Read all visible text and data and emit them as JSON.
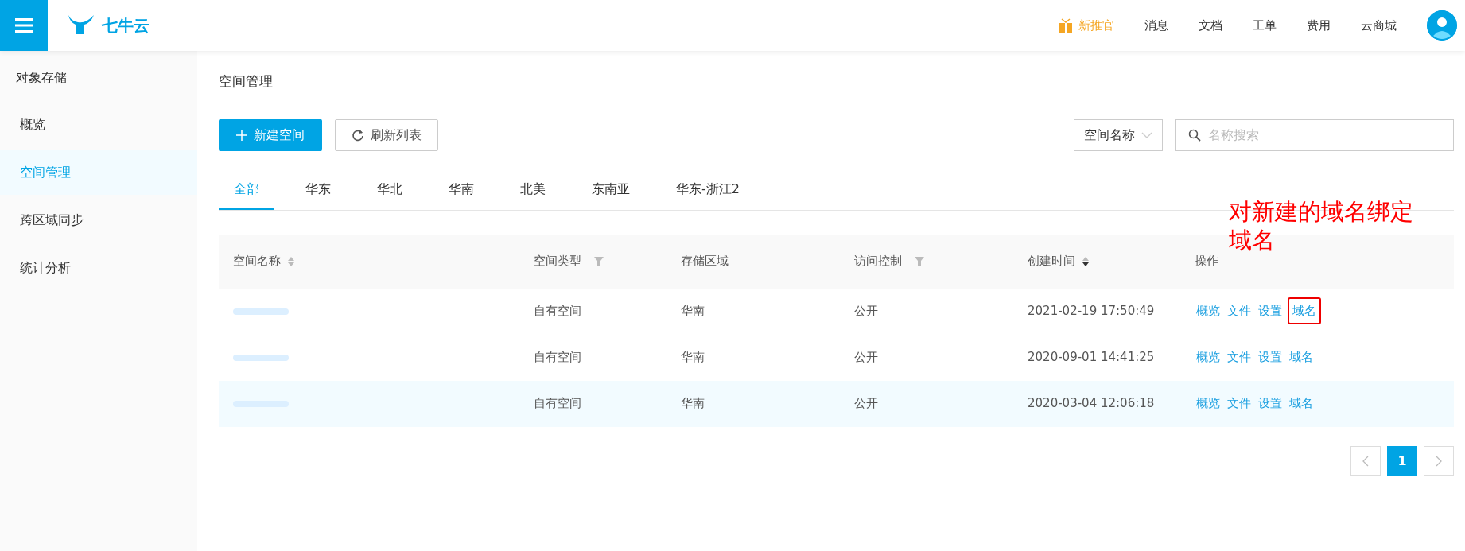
{
  "header": {
    "logo_text": "七牛云",
    "links": [
      {
        "label": "新推官",
        "kind": "promo"
      },
      {
        "label": "消息",
        "kind": "plain"
      },
      {
        "label": "文档",
        "kind": "plain"
      },
      {
        "label": "工单",
        "kind": "plain"
      },
      {
        "label": "费用",
        "kind": "plain"
      },
      {
        "label": "云商城",
        "kind": "plain"
      }
    ]
  },
  "sidebar": {
    "title": "对象存储",
    "items": [
      {
        "label": "概览",
        "selected": false
      },
      {
        "label": "空间管理",
        "selected": true
      },
      {
        "label": "跨区域同步",
        "selected": false
      },
      {
        "label": "统计分析",
        "selected": false
      }
    ]
  },
  "page_title": "空间管理",
  "toolbar": {
    "create_button": "新建空间",
    "refresh_button": "刷新列表",
    "search_by": "空间名称",
    "search": {
      "placeholder": "名称搜索"
    }
  },
  "tabs": [
    {
      "label": "全部",
      "selected": true
    },
    {
      "label": "华东",
      "selected": false
    },
    {
      "label": "华北",
      "selected": false
    },
    {
      "label": "华南",
      "selected": false
    },
    {
      "label": "北美",
      "selected": false
    },
    {
      "label": "东南亚",
      "selected": false
    },
    {
      "label": "华东-浙江2",
      "selected": false
    }
  ],
  "table": {
    "columns": [
      {
        "label": "空间名称",
        "kind": "sortable",
        "sorted_desc": false
      },
      {
        "label": "空间类型",
        "kind": "filterable"
      },
      {
        "label": "存储区域",
        "kind": "plain"
      },
      {
        "label": "访问控制",
        "kind": "filterable"
      },
      {
        "label": "创建时间",
        "kind": "sortable",
        "sorted_desc": true
      },
      {
        "label": "操作",
        "kind": "plain"
      }
    ],
    "rows": [
      {
        "highlighted": false,
        "type": "自有空间",
        "region": "华南",
        "access": "公开",
        "created": "2021-02-19 17:50:49",
        "actions": [
          {
            "label": "概览",
            "boxed": false
          },
          {
            "label": "文件",
            "boxed": false
          },
          {
            "label": "设置",
            "boxed": false
          },
          {
            "label": "域名",
            "boxed": true
          }
        ]
      },
      {
        "highlighted": false,
        "type": "自有空间",
        "region": "华南",
        "access": "公开",
        "created": "2020-09-01 14:41:25",
        "actions": [
          {
            "label": "概览",
            "boxed": false
          },
          {
            "label": "文件",
            "boxed": false
          },
          {
            "label": "设置",
            "boxed": false
          },
          {
            "label": "域名",
            "boxed": false
          }
        ]
      },
      {
        "highlighted": true,
        "type": "自有空间",
        "region": "华南",
        "access": "公开",
        "created": "2020-03-04 12:06:18",
        "actions": [
          {
            "label": "概览",
            "boxed": false
          },
          {
            "label": "文件",
            "boxed": false
          },
          {
            "label": "设置",
            "boxed": false
          },
          {
            "label": "域名",
            "boxed": false
          }
        ]
      }
    ]
  },
  "annotation": {
    "text": "对新建的域名绑定域名"
  },
  "pagination": {
    "pages": [
      {
        "label": "1",
        "selected": true
      }
    ]
  }
}
